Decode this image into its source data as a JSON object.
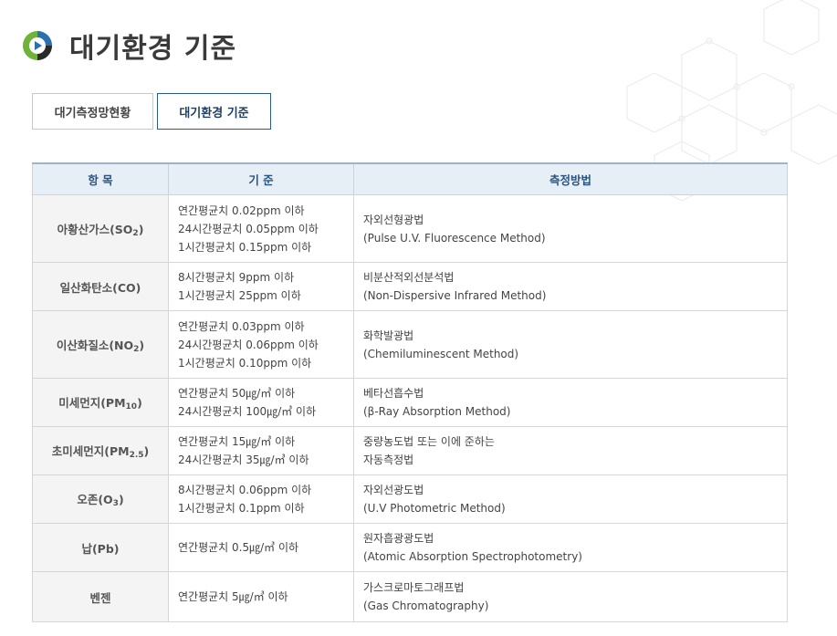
{
  "page": {
    "title": "대기환경 기준"
  },
  "tabs": [
    {
      "label": "대기측정망현황",
      "active": false
    },
    {
      "label": "대기환경 기준",
      "active": true
    }
  ],
  "table": {
    "headers": [
      "항 목",
      "기 준",
      "측정방법"
    ],
    "rows": [
      {
        "item": "아황산가스(SO",
        "item_sub": "2",
        "item_tail": ")",
        "standards": [
          "연간평균치 0.02ppm 이하",
          "24시간평균치 0.05ppm 이하",
          "1시간평균치 0.15ppm 이하"
        ],
        "method": [
          "자외선형광법",
          "(Pulse U.V. Fluorescence Method)"
        ]
      },
      {
        "item": "일산화탄소(CO)",
        "item_sub": "",
        "item_tail": "",
        "standards": [
          "8시간평균치 9ppm 이하",
          "1시간평균치 25ppm 이하"
        ],
        "method": [
          "비분산적외선분석법",
          "(Non-Dispersive Infrared Method)"
        ]
      },
      {
        "item": "이산화질소(NO",
        "item_sub": "2",
        "item_tail": ")",
        "standards": [
          "연간평균치 0.03ppm 이하",
          "24시간평균치 0.06ppm 이하",
          "1시간평균치 0.10ppm 이하"
        ],
        "method": [
          "화학발광법",
          "(Chemiluminescent Method)"
        ]
      },
      {
        "item": "미세먼지(PM",
        "item_sub": "10",
        "item_tail": ")",
        "standards": [
          "연간평균치 50㎍/㎥ 이하",
          "24시간평균치 100㎍/㎥ 이하"
        ],
        "method": [
          "베타선흡수법",
          "(β-Ray Absorption Method)"
        ]
      },
      {
        "item": "초미세먼지(PM",
        "item_sub": "2.5",
        "item_tail": ")",
        "standards": [
          "연간평균치 15㎍/㎥ 이하",
          "24시간평균치 35㎍/㎥ 이하"
        ],
        "method": [
          "중량농도법 또는 이에 준하는",
          "자동측정법"
        ]
      },
      {
        "item": "오존(O",
        "item_sub": "3",
        "item_tail": ")",
        "standards": [
          "8시간평균치 0.06ppm 이하",
          "1시간평균치 0.1ppm 이하"
        ],
        "method": [
          "자외선광도법",
          "(U.V Photometric Method)"
        ]
      },
      {
        "item": "납(Pb)",
        "item_sub": "",
        "item_tail": "",
        "standards": [
          "연간평균치 0.5㎍/㎥ 이하"
        ],
        "method": [
          "원자흡광광도법",
          "(Atomic Absorption Spectrophotometry)"
        ]
      },
      {
        "item": "벤젠",
        "item_sub": "",
        "item_tail": "",
        "standards": [
          "연간평균치 5㎍/㎥ 이하"
        ],
        "method": [
          "가스크로마토그래프법",
          "(Gas Chromatography)"
        ]
      }
    ]
  },
  "colors": {
    "header_bg": "#e6eef6",
    "header_text": "#2a5580",
    "item_bg": "#f4f4f4",
    "active_tab_border": "#2a5b86"
  },
  "icons": {
    "logo": "play-circle-icon"
  }
}
